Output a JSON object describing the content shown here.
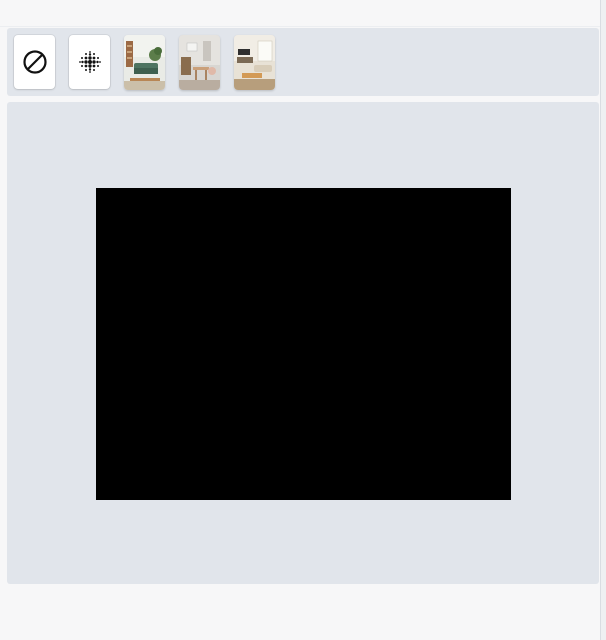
{
  "toolbar": {
    "tools": [
      {
        "id": "none",
        "icon": "no-effect-icon"
      },
      {
        "id": "blur",
        "icon": "halftone-blur-icon"
      }
    ],
    "backgrounds": [
      {
        "id": "bg-1",
        "icon": "living-room-green-sofa-thumbnail"
      },
      {
        "id": "bg-2",
        "icon": "dining-room-thumbnail"
      },
      {
        "id": "bg-3",
        "icon": "bright-living-room-thumbnail"
      }
    ]
  },
  "preview": {
    "icon": "video-preview",
    "background_color": "#000000"
  },
  "colors": {
    "panel": "#e1e5eb",
    "page": "#f7f7f8",
    "button": "#ffffff"
  }
}
